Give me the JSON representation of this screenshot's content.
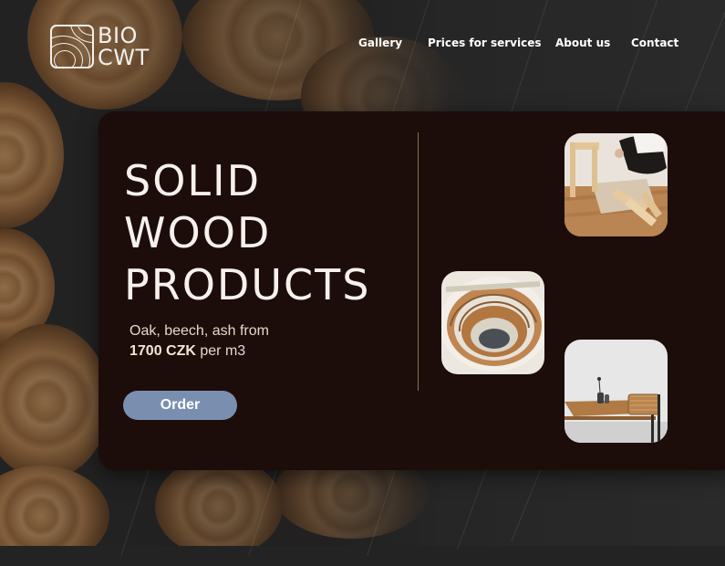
{
  "logo": {
    "line1": "BIO",
    "line2": "CWT"
  },
  "nav": [
    {
      "label": "Gallery"
    },
    {
      "label": "Prices for services"
    },
    {
      "label": "About us"
    },
    {
      "label": "Contact"
    }
  ],
  "hero": {
    "title_line1": "SOLID",
    "title_line2": "WOOD",
    "title_line3": "PRODUCTS",
    "sub_line1": "Oak, beech, ash from",
    "price": "1700 CZK",
    "price_suffix": " per m3",
    "order_label": "Order"
  },
  "photos": [
    {
      "icon": "chair-assembly-photo"
    },
    {
      "icon": "spiral-staircase-photo"
    },
    {
      "icon": "table-and-chair-photo"
    }
  ],
  "colors": {
    "card": "#1c0d0a",
    "button": "#7a8fb0",
    "text": "#f6f1ec"
  }
}
